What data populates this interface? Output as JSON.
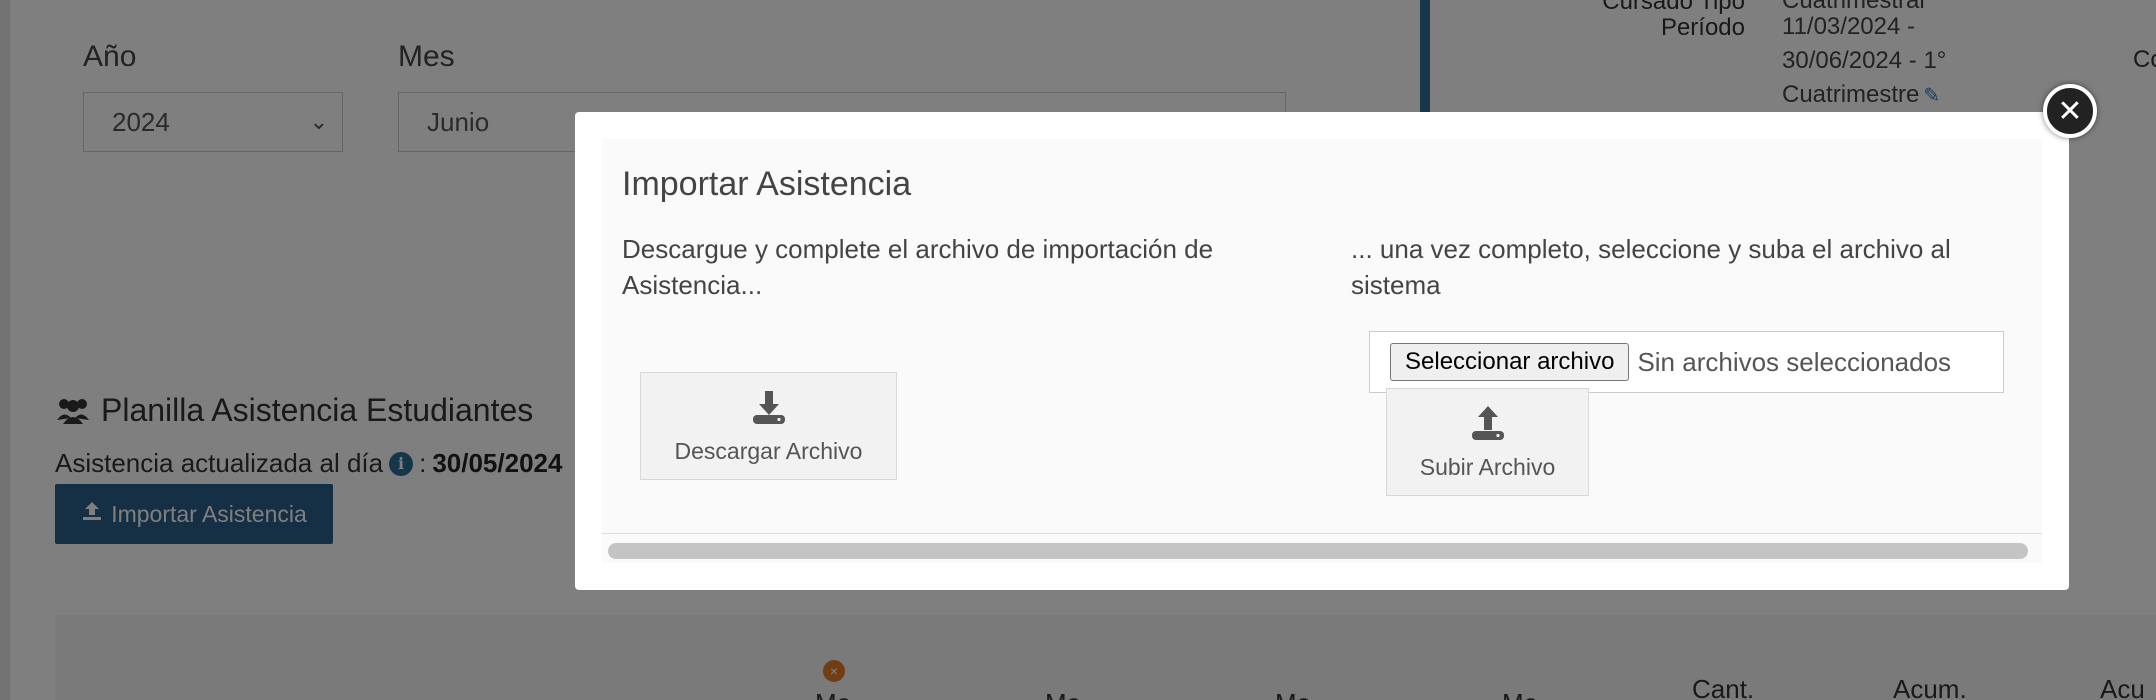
{
  "filters": {
    "year_label": "Año",
    "year_value": "2024",
    "month_label": "Mes",
    "month_value": "Junio"
  },
  "course_info": {
    "type_label": "Cursado Tipo",
    "type_value": "Cuatrimestral",
    "period_label": "Período",
    "period_line1": "11/03/2024 -",
    "period_line2": "30/06/2024 - 1°",
    "period_line3": "Cuatrimestre",
    "right_cut_text": "Co"
  },
  "attendance": {
    "section_title": "Planilla Asistencia Estudiantes",
    "updated_label": "Asistencia actualizada al día",
    "updated_sep": ":",
    "updated_date": "30/05/2024",
    "import_button_label": "Importar Asistencia",
    "col_headers": [
      "Ma",
      "Ma",
      "Ma",
      "Ma",
      "Cant.",
      "Acum.",
      "Acu"
    ]
  },
  "modal": {
    "title": "Importar Asistencia",
    "download_instructions": "Descargue y complete el archivo de importación de Asistencia...",
    "upload_instructions": "... una vez completo, seleccione y suba el archivo al sistema",
    "download_button_label": "Descargar Archivo",
    "file_select_button_label": "Seleccionar archivo",
    "file_status_text": "Sin archivos seleccionados",
    "upload_button_label": "Subir Archivo",
    "close_symbol": "✕"
  },
  "colors": {
    "primary_blue": "#2a5f8a",
    "accent_blue": "#2a6c97",
    "orange": "#e07a2a"
  }
}
